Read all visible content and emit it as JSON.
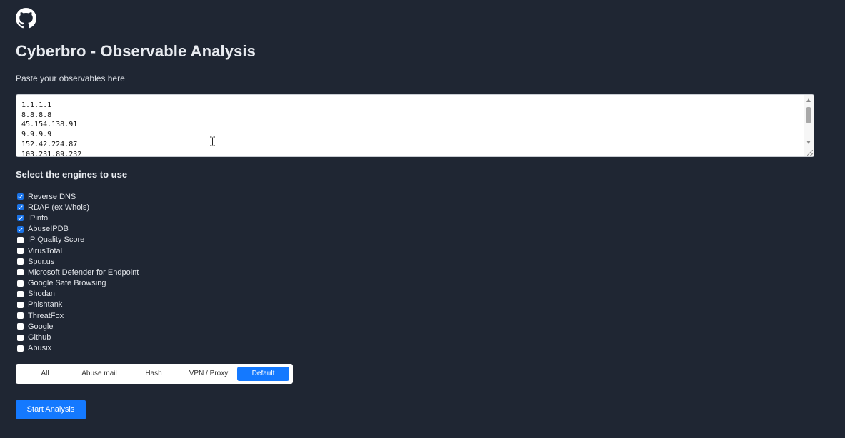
{
  "header": {
    "github_icon": "github-icon",
    "title": "Cyberbro - Observable Analysis"
  },
  "input": {
    "label": "Paste your observables here",
    "value": "1.1.1.1\n8.8.8.8\n45.154.138.91\n9.9.9.9\n152.42.224.87\n103.231.89.232"
  },
  "engines": {
    "heading": "Select the engines to use",
    "items": [
      {
        "label": "Reverse DNS",
        "checked": true
      },
      {
        "label": "RDAP (ex Whois)",
        "checked": true
      },
      {
        "label": "IPinfo",
        "checked": true
      },
      {
        "label": "AbuseIPDB",
        "checked": true
      },
      {
        "label": "IP Quality Score",
        "checked": false
      },
      {
        "label": "VirusTotal",
        "checked": false
      },
      {
        "label": "Spur.us",
        "checked": false
      },
      {
        "label": "Microsoft Defender for Endpoint",
        "checked": false
      },
      {
        "label": "Google Safe Browsing",
        "checked": false
      },
      {
        "label": "Shodan",
        "checked": false
      },
      {
        "label": "Phishtank",
        "checked": false
      },
      {
        "label": "ThreatFox",
        "checked": false
      },
      {
        "label": "Google",
        "checked": false
      },
      {
        "label": "Github",
        "checked": false
      },
      {
        "label": "Abusix",
        "checked": false
      }
    ]
  },
  "presets": {
    "items": [
      {
        "label": "All",
        "active": false
      },
      {
        "label": "Abuse mail",
        "active": false
      },
      {
        "label": "Hash",
        "active": false
      },
      {
        "label": "VPN / Proxy",
        "active": false
      },
      {
        "label": "Default",
        "active": true
      }
    ]
  },
  "actions": {
    "start_label": "Start Analysis"
  },
  "colors": {
    "background": "#1f2633",
    "accent": "#1479ff",
    "checkbox_checked": "#1a73e8"
  }
}
